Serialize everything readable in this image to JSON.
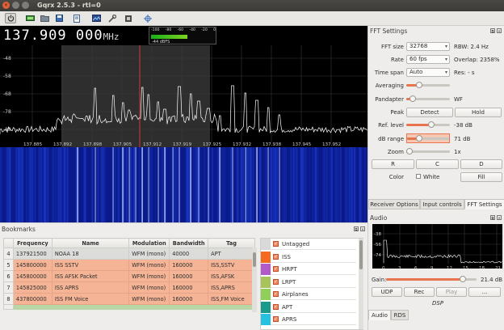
{
  "window": {
    "title": "Gqrx 2.5.3 - rtl=0"
  },
  "toolbar": {
    "icons": [
      "power-icon",
      "device-icon",
      "open-folder-icon",
      "save-icon",
      "document-icon",
      "image-icon",
      "tools-icon",
      "settings-icon",
      "crosshair-icon"
    ],
    "active": "power-icon"
  },
  "frequency": {
    "value": "137.909 000",
    "unit": "MHz"
  },
  "signal_meter": {
    "ticks": [
      "-100",
      "-80",
      "-60",
      "-40",
      "-20",
      "0"
    ],
    "level_dbfs": -44,
    "readout": "-44 dBFS"
  },
  "fft_plot": {
    "y_labels": [
      "-48",
      "-58",
      "-68",
      "-78",
      "-88"
    ],
    "x_labels": [
      "137.885",
      "137.892",
      "137.898",
      "137.905",
      "137.912",
      "137.919",
      "137.925",
      "137.932",
      "137.938",
      "137.945",
      "137.952"
    ],
    "cursor_freq": "137.909",
    "colors": {
      "background": "#000000",
      "trace": "#ffffff",
      "grid": "#3a3a3a",
      "cursor": "#ff3b3b",
      "band": "#ffffff"
    }
  },
  "waterfall": {
    "colors": {
      "low": "#0a1a8a",
      "mid": "#1f3fd6",
      "high": "#c8d4ff"
    }
  },
  "fft_settings": {
    "title": "FFT Settings",
    "fft_size": {
      "label": "FFT size",
      "value": "32768",
      "info": "RBW: 2.4 Hz"
    },
    "rate": {
      "label": "Rate",
      "value": "60 fps",
      "info": "Overlap: 2358%"
    },
    "time_span": {
      "label": "Time span",
      "value": "Auto",
      "info": "Res: - s"
    },
    "averaging": {
      "label": "Averaging",
      "level": 0.3
    },
    "pandapter": {
      "label": "Pandapter",
      "level": 0.15,
      "suffix": "WF"
    },
    "peak": {
      "label": "Peak",
      "detect": "Detect",
      "hold": "Hold"
    },
    "ref_level": {
      "label": "Ref. level",
      "value": "-38 dB",
      "level": 0.58
    },
    "db_range": {
      "label": "dB range",
      "value": "71 dB",
      "level": 0.28
    },
    "zoom": {
      "label": "Zoom",
      "value": "1x",
      "level": 0.02
    },
    "channel_buttons": [
      "R",
      "C",
      "D"
    ],
    "color": {
      "label": "Color",
      "white": "White",
      "fill": "Fill"
    },
    "tabs": [
      "Receiver Options",
      "Input controls",
      "FFT Settings"
    ],
    "active_tab": "FFT Settings"
  },
  "bookmarks": {
    "title": "Bookmarks",
    "columns": [
      "Frequency",
      "Name",
      "Modulation",
      "Bandwidth",
      "Tag"
    ],
    "rows": [
      {
        "n": "4",
        "freq": "137921500",
        "name": "NOAA 18",
        "mod": "WFM (mono)",
        "bw": "40000",
        "tag": "APT"
      },
      {
        "n": "5",
        "freq": "145800000",
        "name": "ISS SSTV",
        "mod": "WFM (mono)",
        "bw": "160000",
        "tag": "ISS,SSTV"
      },
      {
        "n": "6",
        "freq": "145800000",
        "name": "ISS AFSK Packet",
        "mod": "WFM (mono)",
        "bw": "160000",
        "tag": "ISS,AFSK"
      },
      {
        "n": "7",
        "freq": "145825000",
        "name": "ISS APRS",
        "mod": "WFM (mono)",
        "bw": "160000",
        "tag": "ISS,APRS"
      },
      {
        "n": "8",
        "freq": "437800000",
        "name": "ISS FM Voice",
        "mod": "WFM (mono)",
        "bw": "160000",
        "tag": "ISS,FM Voice"
      }
    ],
    "tags": [
      {
        "name": "Untagged",
        "color": "#d9d9d9"
      },
      {
        "name": "ISS",
        "color": "#f46a1f"
      },
      {
        "name": "HRPT",
        "color": "#b25ac8"
      },
      {
        "name": "LRPT",
        "color": "#a7c35a"
      },
      {
        "name": "Airplanes",
        "color": "#8fcf5a"
      },
      {
        "name": "APT",
        "color": "#1a9a8a"
      },
      {
        "name": "APRS",
        "color": "#26c0e0"
      }
    ]
  },
  "audio": {
    "title": "Audio",
    "y_labels": [
      "-38",
      "-56",
      "-74"
    ],
    "x_labels": [
      "0",
      "3",
      "6",
      "9",
      "12",
      "15",
      "18",
      "21"
    ],
    "gain": {
      "label": "Gain:",
      "value": "21.4 dB",
      "level": 0.85
    },
    "buttons": [
      "UDP",
      "Rec",
      "Play",
      "..."
    ],
    "dsp": "DSP",
    "tabs": [
      "Audio",
      "RDS"
    ],
    "active_tab": "Audio"
  }
}
